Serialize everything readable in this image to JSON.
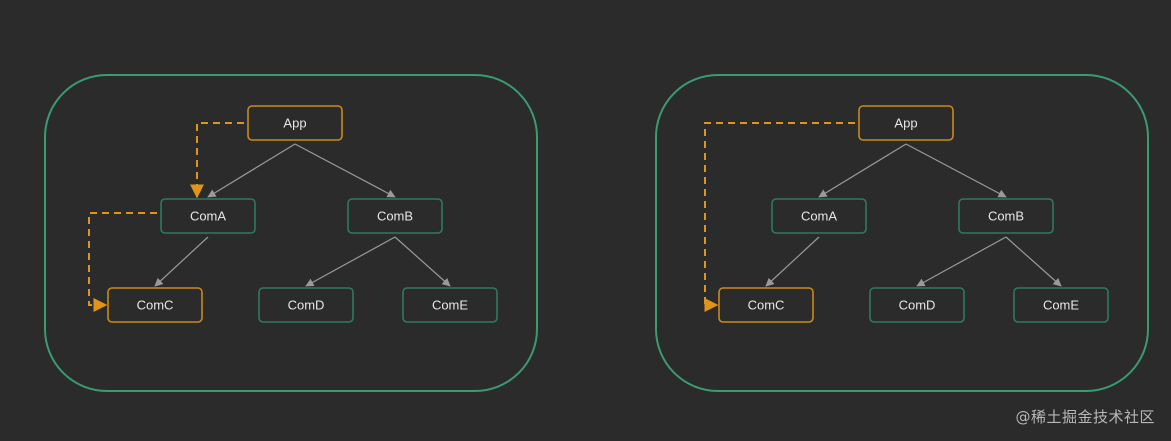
{
  "colors": {
    "background": "#2b2b2b",
    "panel_border": "#3a9a72",
    "node_border": "#2f7a5c",
    "highlight_border": "#c98a1b",
    "tree_edge": "#9a9a9a",
    "label": "#e6e6e6"
  },
  "panels": [
    {
      "nodes": [
        {
          "id": "app",
          "label": "App",
          "highlighted": true
        },
        {
          "id": "coma",
          "label": "ComA",
          "highlighted": false
        },
        {
          "id": "comb",
          "label": "ComB",
          "highlighted": false
        },
        {
          "id": "comc",
          "label": "ComC",
          "highlighted": true
        },
        {
          "id": "comd",
          "label": "ComD",
          "highlighted": false
        },
        {
          "id": "come",
          "label": "ComE",
          "highlighted": false
        }
      ],
      "edges": [
        {
          "from": "app",
          "to": "coma"
        },
        {
          "from": "app",
          "to": "comb"
        },
        {
          "from": "coma",
          "to": "comc"
        },
        {
          "from": "comb",
          "to": "comd"
        },
        {
          "from": "comb",
          "to": "come"
        }
      ],
      "data_flow": [
        {
          "from": "app",
          "to": "coma",
          "style": "dashed"
        },
        {
          "from": "coma",
          "to": "comc",
          "style": "dashed"
        }
      ]
    },
    {
      "nodes": [
        {
          "id": "app",
          "label": "App",
          "highlighted": true
        },
        {
          "id": "coma",
          "label": "ComA",
          "highlighted": false
        },
        {
          "id": "comb",
          "label": "ComB",
          "highlighted": false
        },
        {
          "id": "comc",
          "label": "ComC",
          "highlighted": true
        },
        {
          "id": "comd",
          "label": "ComD",
          "highlighted": false
        },
        {
          "id": "come",
          "label": "ComE",
          "highlighted": false
        }
      ],
      "edges": [
        {
          "from": "app",
          "to": "coma"
        },
        {
          "from": "app",
          "to": "comb"
        },
        {
          "from": "coma",
          "to": "comc"
        },
        {
          "from": "comb",
          "to": "comd"
        },
        {
          "from": "comb",
          "to": "come"
        }
      ],
      "data_flow": [
        {
          "from": "app",
          "to": "comc",
          "style": "dashed"
        }
      ]
    }
  ],
  "watermark": "@稀土掘金技术社区"
}
